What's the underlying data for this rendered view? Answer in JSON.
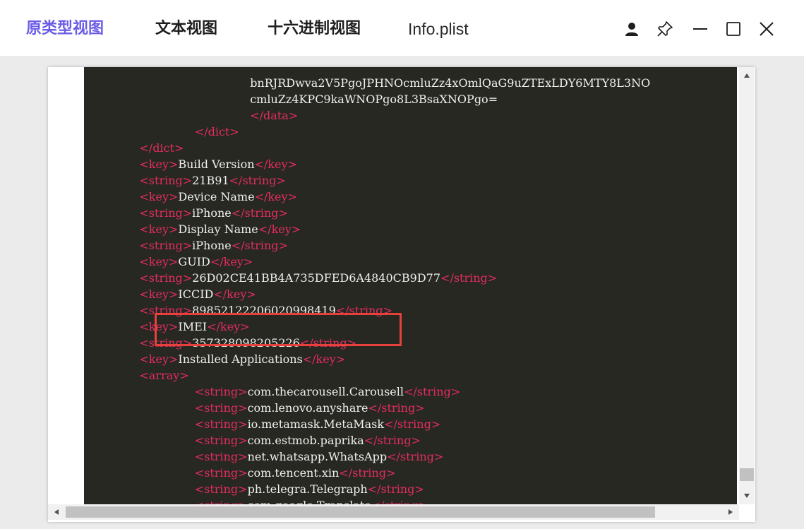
{
  "window": {
    "tabs": [
      {
        "label": "原类型视图",
        "active": true
      },
      {
        "label": "文本视图",
        "active": false
      },
      {
        "label": "十六进制视图",
        "active": false
      },
      {
        "label": "Info.plist",
        "active": false
      }
    ]
  },
  "colors": {
    "active_tab": "#6c5ce7",
    "editor_bg": "#272822",
    "tag": "#e32d5e",
    "text": "#f0f0f0",
    "highlight": "#e8413c"
  },
  "icons": {
    "user": "user-icon",
    "pin": "pin-icon",
    "minimize": "minimize-icon",
    "maximize": "maximize-icon",
    "close": "close-icon"
  },
  "editor": {
    "lines": [
      {
        "indent": 0,
        "parts": []
      },
      {
        "indent": 24,
        "parts": [
          {
            "t": "bnRJRDwva2V5PgoJPHNOcmluZz4xOmlQaG9uZTExLDY6MTY8L3NO",
            "tag": false
          }
        ]
      },
      {
        "indent": 24,
        "parts": [
          {
            "t": "cmluZz4KPC9kaWNOPgo8L3BsaXNOPgo=",
            "tag": false
          }
        ]
      },
      {
        "indent": 24,
        "parts": [
          {
            "t": "</data>",
            "tag": true
          }
        ]
      },
      {
        "indent": 16,
        "parts": [
          {
            "t": "</dict>",
            "tag": true
          }
        ]
      },
      {
        "indent": 8,
        "parts": [
          {
            "t": "</dict>",
            "tag": true
          }
        ]
      },
      {
        "indent": 8,
        "parts": [
          {
            "t": "<key>",
            "tag": true
          },
          {
            "t": "Build Version",
            "tag": false
          },
          {
            "t": "</key>",
            "tag": true
          }
        ]
      },
      {
        "indent": 8,
        "parts": [
          {
            "t": "<string>",
            "tag": true
          },
          {
            "t": "21B91",
            "tag": false
          },
          {
            "t": "</string>",
            "tag": true
          }
        ]
      },
      {
        "indent": 8,
        "parts": [
          {
            "t": "<key>",
            "tag": true
          },
          {
            "t": "Device Name",
            "tag": false
          },
          {
            "t": "</key>",
            "tag": true
          }
        ]
      },
      {
        "indent": 8,
        "parts": [
          {
            "t": "<string>",
            "tag": true
          },
          {
            "t": "iPhone",
            "tag": false
          },
          {
            "t": "</string>",
            "tag": true
          }
        ]
      },
      {
        "indent": 8,
        "parts": [
          {
            "t": "<key>",
            "tag": true
          },
          {
            "t": "Display Name",
            "tag": false
          },
          {
            "t": "</key>",
            "tag": true
          }
        ]
      },
      {
        "indent": 8,
        "parts": [
          {
            "t": "<string>",
            "tag": true
          },
          {
            "t": "iPhone",
            "tag": false
          },
          {
            "t": "</string>",
            "tag": true
          }
        ]
      },
      {
        "indent": 8,
        "parts": [
          {
            "t": "<key>",
            "tag": true
          },
          {
            "t": "GUID",
            "tag": false
          },
          {
            "t": "</key>",
            "tag": true
          }
        ]
      },
      {
        "indent": 8,
        "parts": [
          {
            "t": "<string>",
            "tag": true
          },
          {
            "t": "26D02CE41BB4A735DFED6A4840CB9D77",
            "tag": false
          },
          {
            "t": "</string>",
            "tag": true
          }
        ]
      },
      {
        "indent": 8,
        "parts": [
          {
            "t": "<key>",
            "tag": true
          },
          {
            "t": "ICCID",
            "tag": false
          },
          {
            "t": "</key>",
            "tag": true
          }
        ]
      },
      {
        "indent": 8,
        "parts": [
          {
            "t": "<string>",
            "tag": true
          },
          {
            "t": "89852122206020998419",
            "tag": false
          },
          {
            "t": "</string>",
            "tag": true
          }
        ]
      },
      {
        "indent": 8,
        "parts": [
          {
            "t": "<key>",
            "tag": true
          },
          {
            "t": "IMEI",
            "tag": false
          },
          {
            "t": "</key>",
            "tag": true
          }
        ]
      },
      {
        "indent": 8,
        "parts": [
          {
            "t": "<string>",
            "tag": true
          },
          {
            "t": "357328098205226",
            "tag": false
          },
          {
            "t": "</string>",
            "tag": true
          }
        ]
      },
      {
        "indent": 8,
        "parts": [
          {
            "t": "<key>",
            "tag": true
          },
          {
            "t": "Installed Applications",
            "tag": false
          },
          {
            "t": "</key>",
            "tag": true
          }
        ]
      },
      {
        "indent": 8,
        "parts": [
          {
            "t": "<array>",
            "tag": true
          }
        ]
      },
      {
        "indent": 16,
        "parts": [
          {
            "t": "<string>",
            "tag": true
          },
          {
            "t": "com.thecarousell.Carousell",
            "tag": false
          },
          {
            "t": "</string>",
            "tag": true
          }
        ]
      },
      {
        "indent": 16,
        "parts": [
          {
            "t": "<string>",
            "tag": true
          },
          {
            "t": "com.lenovo.anyshare",
            "tag": false
          },
          {
            "t": "</string>",
            "tag": true
          }
        ]
      },
      {
        "indent": 16,
        "parts": [
          {
            "t": "<string>",
            "tag": true
          },
          {
            "t": "io.metamask.MetaMask",
            "tag": false
          },
          {
            "t": "</string>",
            "tag": true
          }
        ]
      },
      {
        "indent": 16,
        "parts": [
          {
            "t": "<string>",
            "tag": true
          },
          {
            "t": "com.estmob.paprika",
            "tag": false
          },
          {
            "t": "</string>",
            "tag": true
          }
        ]
      },
      {
        "indent": 16,
        "parts": [
          {
            "t": "<string>",
            "tag": true
          },
          {
            "t": "net.whatsapp.WhatsApp",
            "tag": false
          },
          {
            "t": "</string>",
            "tag": true
          }
        ]
      },
      {
        "indent": 16,
        "parts": [
          {
            "t": "<string>",
            "tag": true
          },
          {
            "t": "com.tencent.xin",
            "tag": false
          },
          {
            "t": "</string>",
            "tag": true
          }
        ]
      },
      {
        "indent": 16,
        "parts": [
          {
            "t": "<string>",
            "tag": true
          },
          {
            "t": "ph.telegra.Telegraph",
            "tag": false
          },
          {
            "t": "</string>",
            "tag": true
          }
        ]
      },
      {
        "indent": 16,
        "parts": [
          {
            "t": "<string>",
            "tag": true
          },
          {
            "t": "com.google.Translate",
            "tag": false
          },
          {
            "t": "</string>",
            "tag": true
          }
        ]
      }
    ]
  }
}
